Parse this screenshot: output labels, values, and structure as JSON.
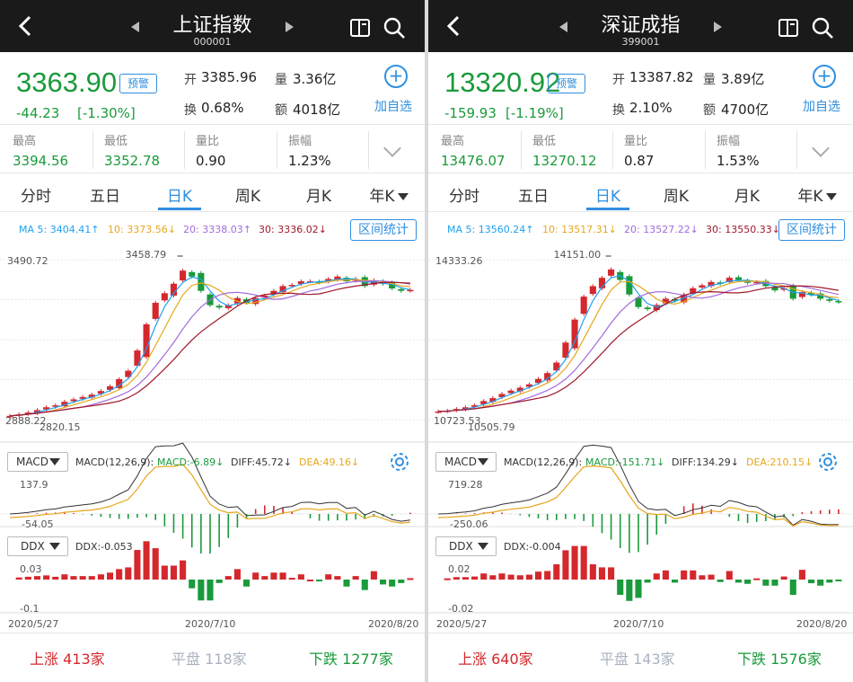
{
  "panels": [
    {
      "title": "上证指数",
      "code": "000001",
      "price": "3363.90",
      "alert_label": "预警",
      "change": "-44.23",
      "change_pct": "[-1.30%]",
      "open_label": "开",
      "open": "3385.96",
      "vol_label": "量",
      "volume": "3.36亿",
      "turn_label": "换",
      "turnover_rate": "0.68%",
      "amt_label": "额",
      "amount": "4018亿",
      "add_label": "加自选",
      "stats": [
        {
          "label": "最高",
          "value": "3394.56"
        },
        {
          "label": "最低",
          "value": "3352.78"
        },
        {
          "label": "量比",
          "value": "0.90"
        },
        {
          "label": "振幅",
          "value": "1.23%"
        }
      ],
      "tabs": [
        "分时",
        "五日",
        "日K",
        "周K",
        "月K",
        "年K"
      ],
      "active_tab": 2,
      "ma": [
        "MA 5: 3404.41↑",
        "10: 3373.56↓",
        "20: 3338.03↑",
        "30: 3336.02↓"
      ],
      "range_button": "区间统计",
      "y_top": "3490.72",
      "peak_label": "3458.79",
      "low_label": "2820.15",
      "y_bottom": "2888.22",
      "macd_select": "MACD",
      "macd_params": "MACD(12,26,9):",
      "macd": "MACD:-6.89↓",
      "diff": "DIFF:45.72↓",
      "dea": "DEA:49.16↓",
      "macd_top": "137.9",
      "macd_bottom": "-54.05",
      "ddx_select": "DDX",
      "ddx": "DDX:-0.053",
      "ddx_top": "0.03",
      "ddx_bottom": "-0.1",
      "dates": [
        "2020/5/27",
        "2020/7/10",
        "2020/8/20"
      ],
      "up_label": "上涨",
      "up": "413家",
      "flat_label": "平盘",
      "flat": "118家",
      "down_label": "下跌",
      "down": "1277家"
    },
    {
      "title": "深证成指",
      "code": "399001",
      "price": "13320.92",
      "alert_label": "预警",
      "change": "-159.93",
      "change_pct": "[-1.19%]",
      "open_label": "开",
      "open": "13387.82",
      "vol_label": "量",
      "volume": "3.89亿",
      "turn_label": "换",
      "turnover_rate": "2.10%",
      "amt_label": "额",
      "amount": "4700亿",
      "add_label": "加自选",
      "stats": [
        {
          "label": "最高",
          "value": "13476.07"
        },
        {
          "label": "最低",
          "value": "13270.12"
        },
        {
          "label": "量比",
          "value": "0.87"
        },
        {
          "label": "振幅",
          "value": "1.53%"
        }
      ],
      "tabs": [
        "分时",
        "五日",
        "日K",
        "周K",
        "月K",
        "年K"
      ],
      "active_tab": 2,
      "ma": [
        "MA 5: 13560.24↑",
        "10: 13517.31↓",
        "20: 13527.22↓",
        "30: 13550.33↓"
      ],
      "range_button": "区间统计",
      "y_top": "14333.26",
      "peak_label": "14151.00",
      "low_label": "10505.79",
      "y_bottom": "10723.53",
      "macd_select": "MACD",
      "macd_params": "MACD(12,26,9):",
      "macd": "MACD:-151.71↓",
      "diff": "DIFF:134.29↓",
      "dea": "DEA:210.15↓",
      "macd_top": "719.28",
      "macd_bottom": "-250.06",
      "ddx_select": "DDX",
      "ddx": "DDX:-0.004",
      "ddx_top": "0.02",
      "ddx_bottom": "-0.02",
      "dates": [
        "2020/5/27",
        "2020/7/10",
        "2020/8/20"
      ],
      "up_label": "上涨",
      "up": "640家",
      "flat_label": "平盘",
      "flat": "143家",
      "down_label": "下跌",
      "down": "1576家"
    }
  ],
  "chart_data": [
    {
      "type": "candlestick",
      "title": "上证指数",
      "x_range": [
        "2020/5/27",
        "2020/8/20"
      ],
      "ylim": [
        2820.15,
        3490.72
      ],
      "x": [
        "2020/5/27",
        "2020/7/10",
        "2020/8/20"
      ],
      "price_path": [
        2836,
        2842,
        2850,
        2860,
        2872,
        2880,
        2895,
        2905,
        2915,
        2925,
        2940,
        2960,
        2990,
        3025,
        3110,
        3220,
        3310,
        3350,
        3390,
        3445,
        3420,
        3360,
        3300,
        3290,
        3300,
        3330,
        3310,
        3330,
        3340,
        3360,
        3380,
        3385,
        3400,
        3400,
        3395,
        3410,
        3420,
        3400,
        3410,
        3380,
        3404,
        3390,
        3370,
        3360,
        3364
      ],
      "series": [
        {
          "name": "MA 5",
          "color": "#1da1f2"
        },
        {
          "name": "MA 10",
          "color": "#e6a71c"
        },
        {
          "name": "MA 20",
          "color": "#a26bdc"
        },
        {
          "name": "MA 30",
          "color": "#a0182b"
        }
      ]
    },
    {
      "type": "candlestick",
      "title": "深证成指",
      "x_range": [
        "2020/5/27",
        "2020/8/20"
      ],
      "ylim": [
        10505.79,
        14333.26
      ],
      "x": [
        "2020/5/27",
        "2020/7/10",
        "2020/8/20"
      ],
      "price_path": [
        10700,
        10720,
        10760,
        10800,
        10850,
        10950,
        11020,
        11120,
        11200,
        11270,
        11350,
        11480,
        11620,
        11870,
        12350,
        12900,
        13450,
        13700,
        13900,
        14100,
        13850,
        13500,
        13200,
        13150,
        13250,
        13400,
        13350,
        13500,
        13650,
        13720,
        13800,
        13760,
        13900,
        13850,
        13780,
        13800,
        13700,
        13600,
        13650,
        13400,
        13560,
        13500,
        13400,
        13350,
        13321
      ],
      "series": [
        {
          "name": "MA 5",
          "color": "#1da1f2"
        },
        {
          "name": "MA 10",
          "color": "#e6a71c"
        },
        {
          "name": "MA 20",
          "color": "#a26bdc"
        },
        {
          "name": "MA 30",
          "color": "#a0182b"
        }
      ]
    }
  ],
  "colors": {
    "up": "#d4282d",
    "down": "#1a9a3b",
    "accent": "#2f8fe0",
    "header": "#1a1a1a"
  },
  "icons": [
    "back-icon",
    "prev-arrow-icon",
    "next-arrow-icon",
    "compare-icon",
    "search-icon",
    "add-icon",
    "chevron-down-icon",
    "settings-gear-icon"
  ]
}
